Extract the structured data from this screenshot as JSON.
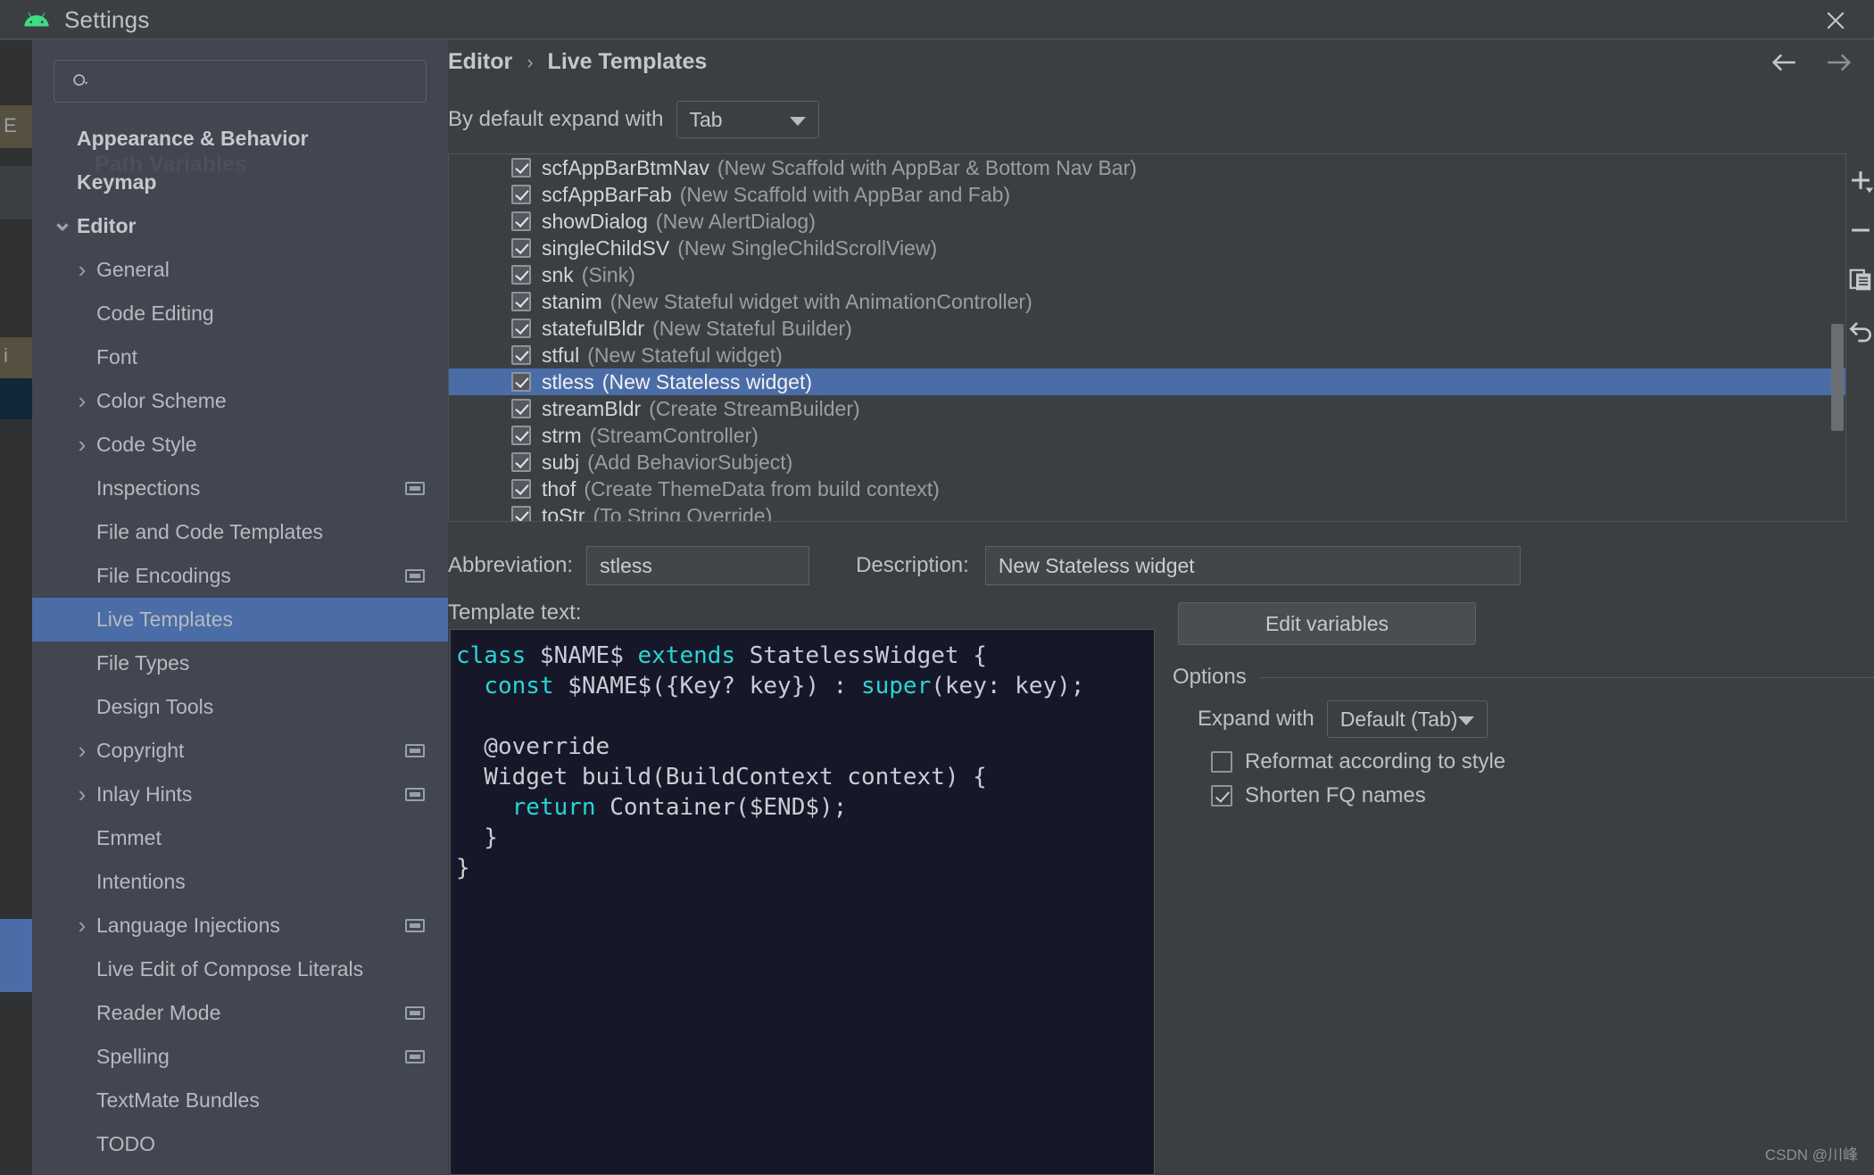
{
  "window": {
    "title": "Settings",
    "app_icon": "android-icon",
    "close_icon": "close-icon"
  },
  "sidebar": {
    "search": {
      "placeholder": "",
      "value": "",
      "icon": "search-icon"
    },
    "ghost_row": "Path Variables",
    "items": [
      {
        "label": "Appearance & Behavior",
        "level": 0,
        "bold": true,
        "twisty": "",
        "badge": false,
        "selected": false
      },
      {
        "label": "Keymap",
        "level": 0,
        "bold": true,
        "twisty": "",
        "badge": false,
        "selected": false
      },
      {
        "label": "Editor",
        "level": 0,
        "bold": true,
        "twisty": "v",
        "badge": false,
        "selected": false
      },
      {
        "label": "General",
        "level": 1,
        "bold": false,
        "twisty": ">",
        "badge": false,
        "selected": false
      },
      {
        "label": "Code Editing",
        "level": 1,
        "bold": false,
        "twisty": "",
        "badge": false,
        "selected": false
      },
      {
        "label": "Font",
        "level": 1,
        "bold": false,
        "twisty": "",
        "badge": false,
        "selected": false
      },
      {
        "label": "Color Scheme",
        "level": 1,
        "bold": false,
        "twisty": ">",
        "badge": false,
        "selected": false
      },
      {
        "label": "Code Style",
        "level": 1,
        "bold": false,
        "twisty": ">",
        "badge": false,
        "selected": false
      },
      {
        "label": "Inspections",
        "level": 1,
        "bold": false,
        "twisty": "",
        "badge": true,
        "selected": false
      },
      {
        "label": "File and Code Templates",
        "level": 1,
        "bold": false,
        "twisty": "",
        "badge": false,
        "selected": false
      },
      {
        "label": "File Encodings",
        "level": 1,
        "bold": false,
        "twisty": "",
        "badge": true,
        "selected": false
      },
      {
        "label": "Live Templates",
        "level": 1,
        "bold": false,
        "twisty": "",
        "badge": false,
        "selected": true
      },
      {
        "label": "File Types",
        "level": 1,
        "bold": false,
        "twisty": "",
        "badge": false,
        "selected": false
      },
      {
        "label": "Design Tools",
        "level": 1,
        "bold": false,
        "twisty": "",
        "badge": false,
        "selected": false
      },
      {
        "label": "Copyright",
        "level": 1,
        "bold": false,
        "twisty": ">",
        "badge": true,
        "selected": false
      },
      {
        "label": "Inlay Hints",
        "level": 1,
        "bold": false,
        "twisty": ">",
        "badge": true,
        "selected": false
      },
      {
        "label": "Emmet",
        "level": 1,
        "bold": false,
        "twisty": "",
        "badge": false,
        "selected": false
      },
      {
        "label": "Intentions",
        "level": 1,
        "bold": false,
        "twisty": "",
        "badge": false,
        "selected": false
      },
      {
        "label": "Language Injections",
        "level": 1,
        "bold": false,
        "twisty": ">",
        "badge": true,
        "selected": false
      },
      {
        "label": "Live Edit of Compose Literals",
        "level": 1,
        "bold": false,
        "twisty": "",
        "badge": false,
        "selected": false
      },
      {
        "label": "Reader Mode",
        "level": 1,
        "bold": false,
        "twisty": "",
        "badge": true,
        "selected": false
      },
      {
        "label": "Spelling",
        "level": 1,
        "bold": false,
        "twisty": "",
        "badge": true,
        "selected": false
      },
      {
        "label": "TextMate Bundles",
        "level": 1,
        "bold": false,
        "twisty": "",
        "badge": false,
        "selected": false
      },
      {
        "label": "TODO",
        "level": 1,
        "bold": false,
        "twisty": "",
        "badge": false,
        "selected": false
      }
    ]
  },
  "breadcrumb": {
    "parent": "Editor",
    "separator": "›",
    "current": "Live Templates",
    "back_icon": "arrow-left-icon",
    "forward_icon": "arrow-right-icon"
  },
  "expand_default": {
    "label": "By default expand with",
    "value": "Tab"
  },
  "template_list": {
    "toolbar": [
      {
        "icon": "plus-icon",
        "name": "add-template-button"
      },
      {
        "icon": "minus-icon",
        "name": "remove-template-button"
      },
      {
        "icon": "duplicate-icon",
        "name": "duplicate-template-button"
      },
      {
        "icon": "revert-icon",
        "name": "revert-template-button"
      }
    ],
    "rows": [
      {
        "checked": true,
        "abbr": "scfAppBarBtmNav",
        "desc": "(New Scaffold with AppBar & Bottom Nav Bar)",
        "selected": false
      },
      {
        "checked": true,
        "abbr": "scfAppBarFab",
        "desc": "(New Scaffold with AppBar and Fab)",
        "selected": false
      },
      {
        "checked": true,
        "abbr": "showDialog",
        "desc": "(New AlertDialog)",
        "selected": false
      },
      {
        "checked": true,
        "abbr": "singleChildSV",
        "desc": "(New SingleChildScrollView)",
        "selected": false
      },
      {
        "checked": true,
        "abbr": "snk",
        "desc": "(Sink)",
        "selected": false
      },
      {
        "checked": true,
        "abbr": "stanim",
        "desc": "(New Stateful widget with AnimationController)",
        "selected": false
      },
      {
        "checked": true,
        "abbr": "statefulBldr",
        "desc": "(New Stateful Builder)",
        "selected": false
      },
      {
        "checked": true,
        "abbr": "stful",
        "desc": "(New Stateful widget)",
        "selected": false
      },
      {
        "checked": true,
        "abbr": "stless",
        "desc": "(New Stateless widget)",
        "selected": true
      },
      {
        "checked": true,
        "abbr": "streamBldr",
        "desc": "(Create StreamBuilder)",
        "selected": false
      },
      {
        "checked": true,
        "abbr": "strm",
        "desc": "(StreamController)",
        "selected": false
      },
      {
        "checked": true,
        "abbr": "subj",
        "desc": "(Add BehaviorSubject)",
        "selected": false
      },
      {
        "checked": true,
        "abbr": "thof",
        "desc": "(Create ThemeData from build context)",
        "selected": false
      },
      {
        "checked": true,
        "abbr": "toStr",
        "desc": "(To String Override)",
        "selected": false
      }
    ]
  },
  "detail": {
    "abbreviation_label": "Abbreviation:",
    "abbreviation_value": "stless",
    "description_label": "Description:",
    "description_value": "New Stateless widget",
    "template_text_label": "Template text:",
    "code_lines": [
      [
        {
          "t": "class ",
          "c": "kw"
        },
        {
          "t": "$NAME$ ",
          "c": "pl"
        },
        {
          "t": "extends ",
          "c": "kw"
        },
        {
          "t": "StatelessWidget {",
          "c": "pl"
        }
      ],
      [
        {
          "t": "  ",
          "c": "pl"
        },
        {
          "t": "const ",
          "c": "kw"
        },
        {
          "t": "$NAME$({Key? key}) : ",
          "c": "pl"
        },
        {
          "t": "super",
          "c": "kw"
        },
        {
          "t": "(key: key);",
          "c": "pl"
        }
      ],
      [
        {
          "t": "",
          "c": "pl"
        }
      ],
      [
        {
          "t": "  @override",
          "c": "pl"
        }
      ],
      [
        {
          "t": "  Widget build(BuildContext context) {",
          "c": "pl"
        }
      ],
      [
        {
          "t": "    ",
          "c": "pl"
        },
        {
          "t": "return ",
          "c": "kw"
        },
        {
          "t": "Container($END$);",
          "c": "pl"
        }
      ],
      [
        {
          "t": "  }",
          "c": "pl"
        }
      ],
      [
        {
          "t": "}",
          "c": "pl"
        }
      ]
    ]
  },
  "options": {
    "edit_variables_label": "Edit variables",
    "title": "Options",
    "expand_with_label": "Expand with",
    "expand_with_value": "Default (Tab)",
    "checkboxes": [
      {
        "label": "Reformat according to style",
        "checked": false
      },
      {
        "label": "Shorten FQ names",
        "checked": true
      }
    ]
  },
  "watermark": "CSDN @川峰",
  "colors": {
    "accent": "#4a6da7",
    "dialog_bg": "#3c3f41",
    "sidebar_bg": "#414650",
    "editor_bg": "#16182a",
    "keyword": "#2ad4d4",
    "android_green": "#3ddc84"
  }
}
